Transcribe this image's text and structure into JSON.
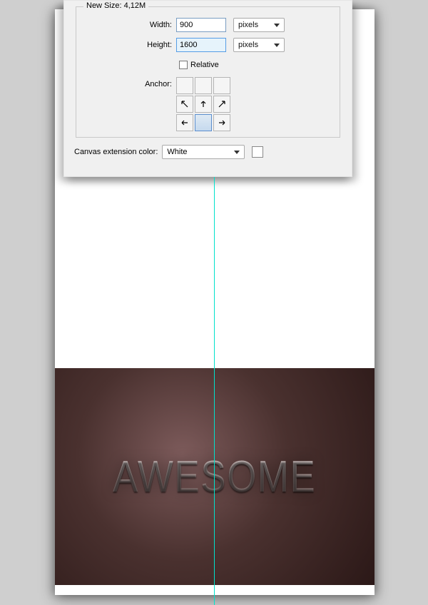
{
  "dialog": {
    "fieldset_legend": "New Size: 4,12M",
    "width_label": "Width:",
    "width_value": "900",
    "height_label": "Height:",
    "height_value": "1600",
    "unit": "pixels",
    "relative_label": "Relative",
    "anchor_label": "Anchor:",
    "extension_label": "Canvas extension color:",
    "extension_value": "White"
  },
  "artwork": {
    "text": "AWESOME"
  }
}
